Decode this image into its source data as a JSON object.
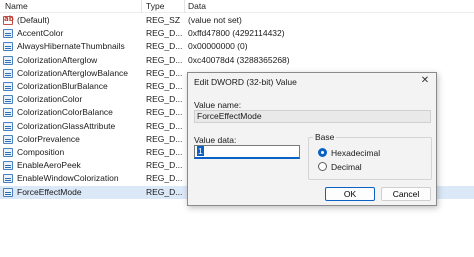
{
  "columns": {
    "name": "Name",
    "type": "Type",
    "data": "Data"
  },
  "rows": [
    {
      "name": "(Default)",
      "type": "REG_SZ",
      "data": "(value not set)",
      "icon": "string-value-icon"
    },
    {
      "name": "AccentColor",
      "type": "REG_D...",
      "data": "0xffd47800 (4292114432)",
      "icon": "binary-value-icon"
    },
    {
      "name": "AlwaysHibernateThumbnails",
      "type": "REG_D...",
      "data": "0x00000000 (0)",
      "icon": "binary-value-icon"
    },
    {
      "name": "ColorizationAfterglow",
      "type": "REG_D...",
      "data": "0xc40078d4 (3288365268)",
      "icon": "binary-value-icon"
    },
    {
      "name": "ColorizationAfterglowBalance",
      "type": "REG_D...",
      "data": "",
      "icon": "binary-value-icon"
    },
    {
      "name": "ColorizationBlurBalance",
      "type": "REG_D...",
      "data": "",
      "icon": "binary-value-icon"
    },
    {
      "name": "ColorizationColor",
      "type": "REG_D...",
      "data": "",
      "icon": "binary-value-icon"
    },
    {
      "name": "ColorizationColorBalance",
      "type": "REG_D...",
      "data": "",
      "icon": "binary-value-icon"
    },
    {
      "name": "ColorizationGlassAttribute",
      "type": "REG_D...",
      "data": "",
      "icon": "binary-value-icon"
    },
    {
      "name": "ColorPrevalence",
      "type": "REG_D...",
      "data": "",
      "icon": "binary-value-icon"
    },
    {
      "name": "Composition",
      "type": "REG_D...",
      "data": "",
      "icon": "binary-value-icon"
    },
    {
      "name": "EnableAeroPeek",
      "type": "REG_D...",
      "data": "",
      "icon": "binary-value-icon"
    },
    {
      "name": "EnableWindowColorization",
      "type": "REG_D...",
      "data": "",
      "icon": "binary-value-icon"
    },
    {
      "name": "ForceEffectMode",
      "type": "REG_D...",
      "data": "",
      "icon": "binary-value-icon"
    }
  ],
  "dialog": {
    "title": "Edit DWORD (32-bit) Value",
    "close_glyph": "✕",
    "value_name_label": "Value name:",
    "value_name": "ForceEffectMode",
    "value_data_label": "Value data:",
    "value_data": "1",
    "base_label": "Base",
    "hex_label": "Hexadecimal",
    "dec_label": "Decimal",
    "ok_label": "OK",
    "cancel_label": "Cancel"
  },
  "colors": {
    "accent": "#0b61c4",
    "selection": "#dbe8f8"
  }
}
